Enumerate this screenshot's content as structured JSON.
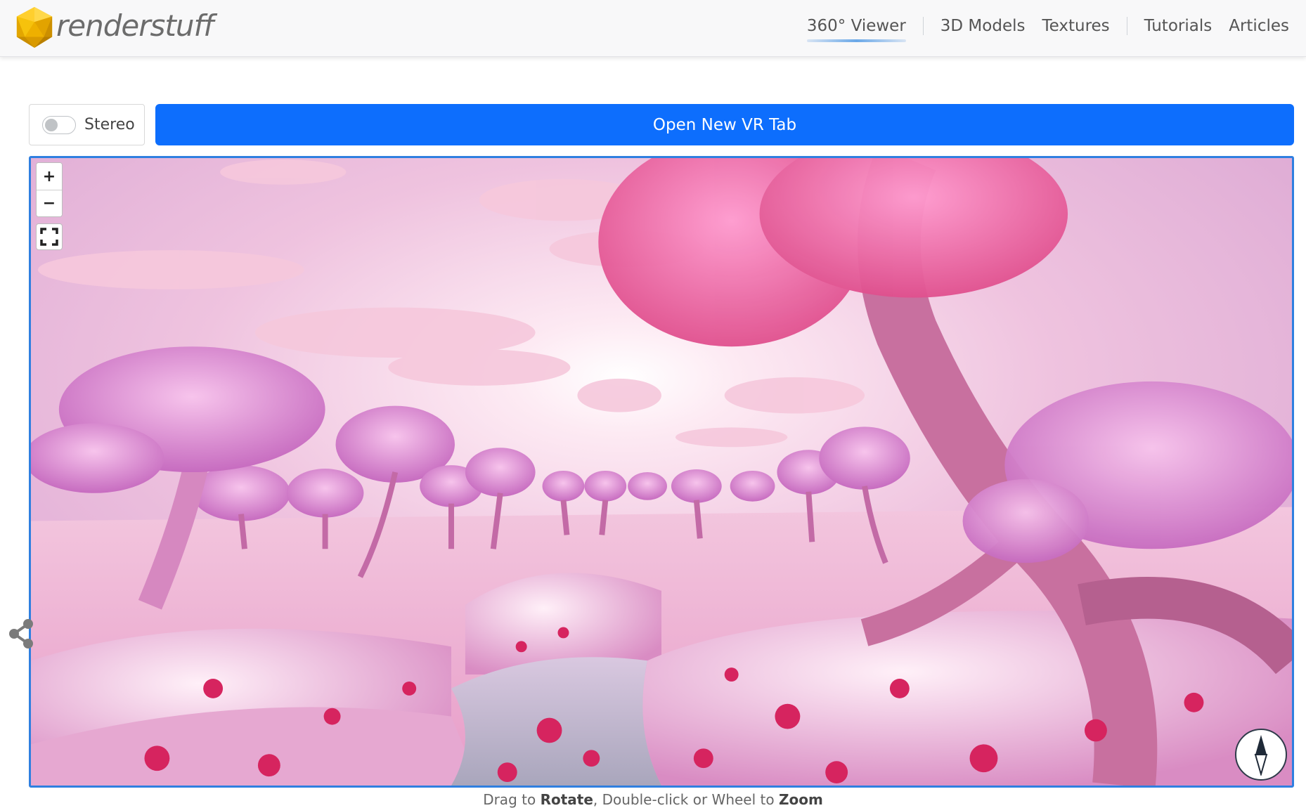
{
  "header": {
    "logo_text": "renderstuff",
    "nav": [
      {
        "label": "360° Viewer",
        "active": true
      },
      {
        "label": "3D Models",
        "active": false
      },
      {
        "label": "Textures",
        "active": false
      },
      {
        "label": "Tutorials",
        "active": false
      },
      {
        "label": "Articles",
        "active": false
      }
    ]
  },
  "controls": {
    "stereo_label": "Stereo",
    "stereo_on": false,
    "vr_button_label": "Open New VR Tab"
  },
  "viewer": {
    "zoom_in_label": "+",
    "zoom_out_label": "−"
  },
  "hint": {
    "part1": "Drag to ",
    "bold1": "Rotate",
    "part2": ", Double-click or Wheel to ",
    "bold2": "Zoom"
  },
  "colors": {
    "accent": "#0d6efd",
    "viewer_border": "#2f7fe0",
    "logo_gold": "#f2b705"
  },
  "icons": [
    "logo-icosahedron-icon",
    "fullscreen-icon",
    "compass-icon",
    "share-icon"
  ]
}
